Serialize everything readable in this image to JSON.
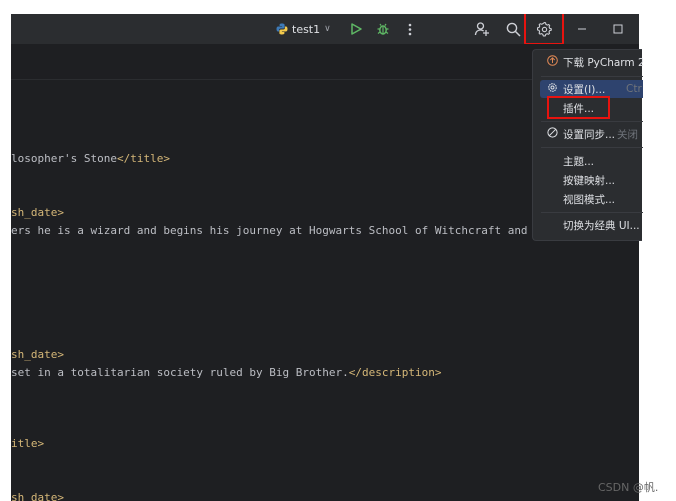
{
  "toolbar": {
    "run_config": "test1",
    "run_config_chevron": "∨"
  },
  "code": {
    "line1_text": "losopher's Stone",
    "line1_tag": "</title>",
    "line2_tag": "sh_date>",
    "line3_text": "ers he is a wizard and begins his journey at Hogwarts School of Witchcraft and Wi",
    "line4_tag": "sh_date>",
    "line5_text": "set in a totalitarian society ruled by Big Brother.",
    "line5_tag": "</description>",
    "line6_tag": "itle>",
    "line7_tag": "sh_date>"
  },
  "menu": {
    "download": "下载 PyCharm 2",
    "settings": "设置(I)...",
    "settings_shortcut": "Ctr",
    "plugins": "插件...",
    "sync": "设置同步...",
    "sync_status": "关闭",
    "theme": "主题...",
    "keymap": "按键映射...",
    "view_mode": "视图模式...",
    "switch_ui": "切换为经典 UI..."
  },
  "watermark": "CSDN @帆."
}
